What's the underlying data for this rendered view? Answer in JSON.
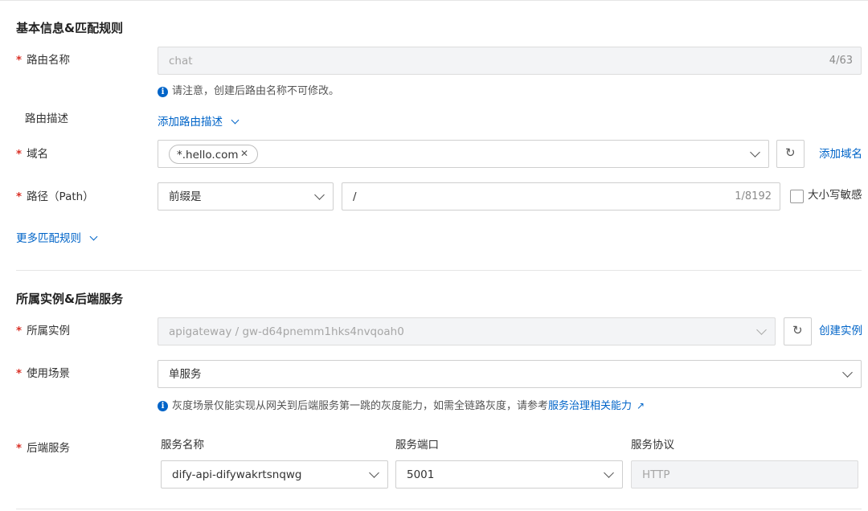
{
  "sections": {
    "basic_title": "基本信息&匹配规则",
    "instance_title": "所属实例&后端服务"
  },
  "required_mark": "*",
  "route_name": {
    "label": "路由名称",
    "value": "chat",
    "count": "4/63",
    "hint": "请注意，创建后路由名称不可修改。"
  },
  "route_desc": {
    "label": "路由描述",
    "link": "添加路由描述"
  },
  "domain": {
    "label": "域名",
    "tag": "*.hello.com",
    "add_link": "添加域名"
  },
  "path": {
    "label": "路径（Path）",
    "match_type": "前缀是",
    "value": "/",
    "count": "1/8192",
    "case_label": "大小写敏感",
    "case_checked": false
  },
  "more_rules_link": "更多匹配规则",
  "instance": {
    "label": "所属实例",
    "value": "apigateway / gw-d64pnemm1hks4nvqoah0",
    "create_link": "创建实例"
  },
  "scenario": {
    "label": "使用场景",
    "value": "单服务",
    "hint": "灰度场景仅能实现从网关到后端服务第一跳的灰度能力，如需全链路灰度，请参考",
    "hint_link": "服务治理相关能力"
  },
  "backend": {
    "label": "后端服务",
    "col_name": "服务名称",
    "col_port": "服务端口",
    "col_protocol": "服务协议",
    "service_name": "dify-api-difywakrtsnqwg",
    "port": "5001",
    "protocol": "HTTP"
  },
  "icons": {
    "info": "i",
    "close": "✕",
    "refresh": "↻",
    "external": "↗"
  },
  "colors": {
    "accent": "#0064c8",
    "required": "#d93026"
  }
}
